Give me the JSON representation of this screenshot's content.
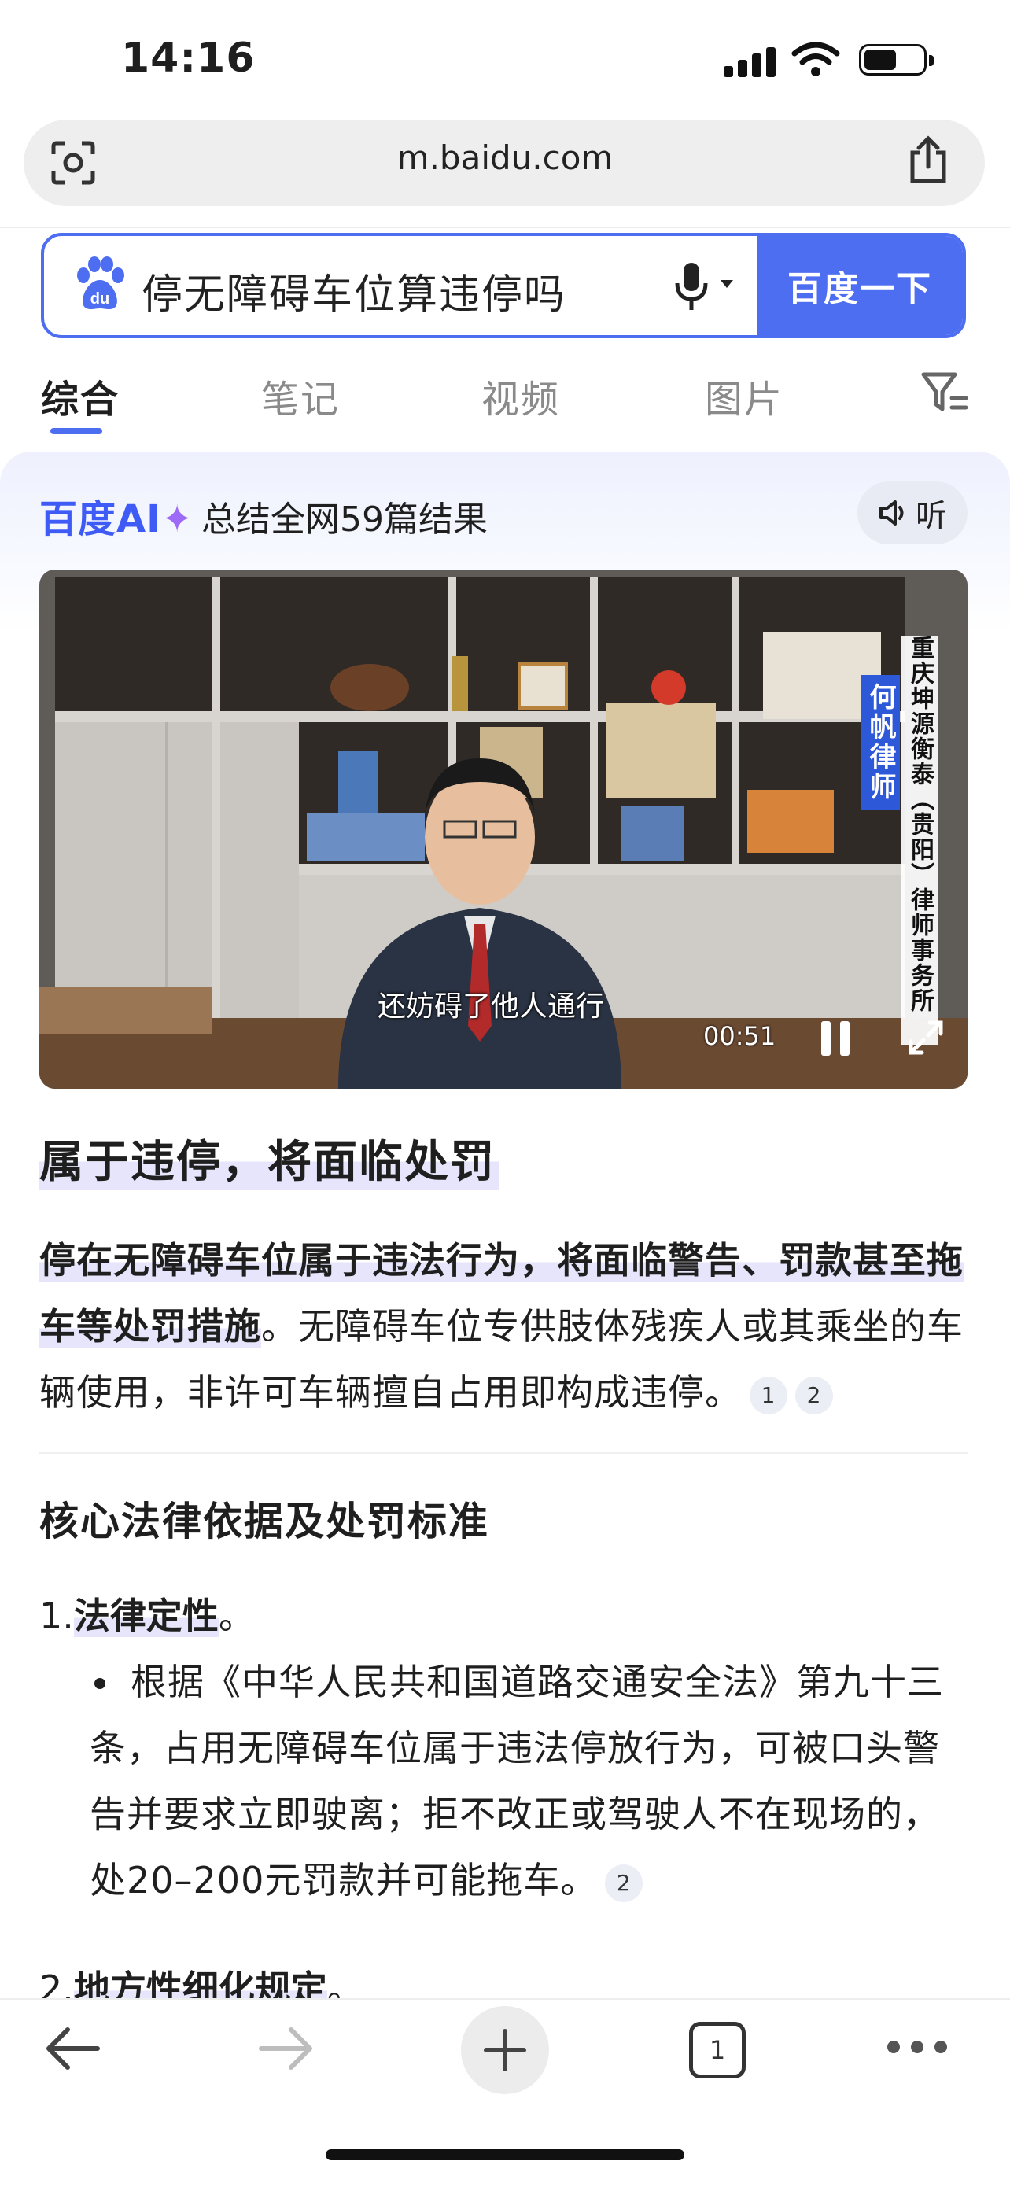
{
  "status_bar": {
    "time": "14:16"
  },
  "browser": {
    "url": "m.baidu.com"
  },
  "search": {
    "query": "停无障碍车位算违停吗",
    "button_label": "百度一下"
  },
  "tabs": [
    {
      "label": "综合",
      "active": true
    },
    {
      "label": "笔记",
      "active": false
    },
    {
      "label": "视频",
      "active": false
    },
    {
      "label": "图片",
      "active": false
    }
  ],
  "ai_card": {
    "logo_text": "百度AI",
    "summary": "总结全网59篇结果",
    "listen_label": "听"
  },
  "video": {
    "subtitle": "还妨碍了他人通行",
    "time": "00:51",
    "name_banner": "何帆律师",
    "firm_banner": "重庆坤源衡泰（贵阳）律师事务所"
  },
  "article": {
    "headline": "属于违停，将面临处罚",
    "para_highlight": "停在无障碍车位属于违法行为，将面临警告、罚款甚至拖车等处罚措施",
    "para_rest": "。无障碍车位专供肢体残疾人或其乘坐的车辆使用，非许可车辆擅自占用即构成违停。",
    "para_cites": [
      "1",
      "2"
    ],
    "section_title": "核心法律依据及处罚标准",
    "item1_num": "1.",
    "item1_label": "法律定性",
    "item1_end": "。",
    "bullet1": "根据《中华人民共和国道路交通安全法》第九十三条，占用无障碍车位属于违法停放行为，可被口头警告并要求立即驶离；拒不改正或驾驶人不在现场的，处20–200元罚款并可能拖车。",
    "bullet1_cite": "2",
    "item2_num": "2.",
    "item2_label": "地方性细化规定",
    "item2_end": "。"
  },
  "toolbar": {
    "tab_count": "1"
  },
  "colors": {
    "accent": "#4e6ef2",
    "highlight": "#e6e5fb"
  }
}
